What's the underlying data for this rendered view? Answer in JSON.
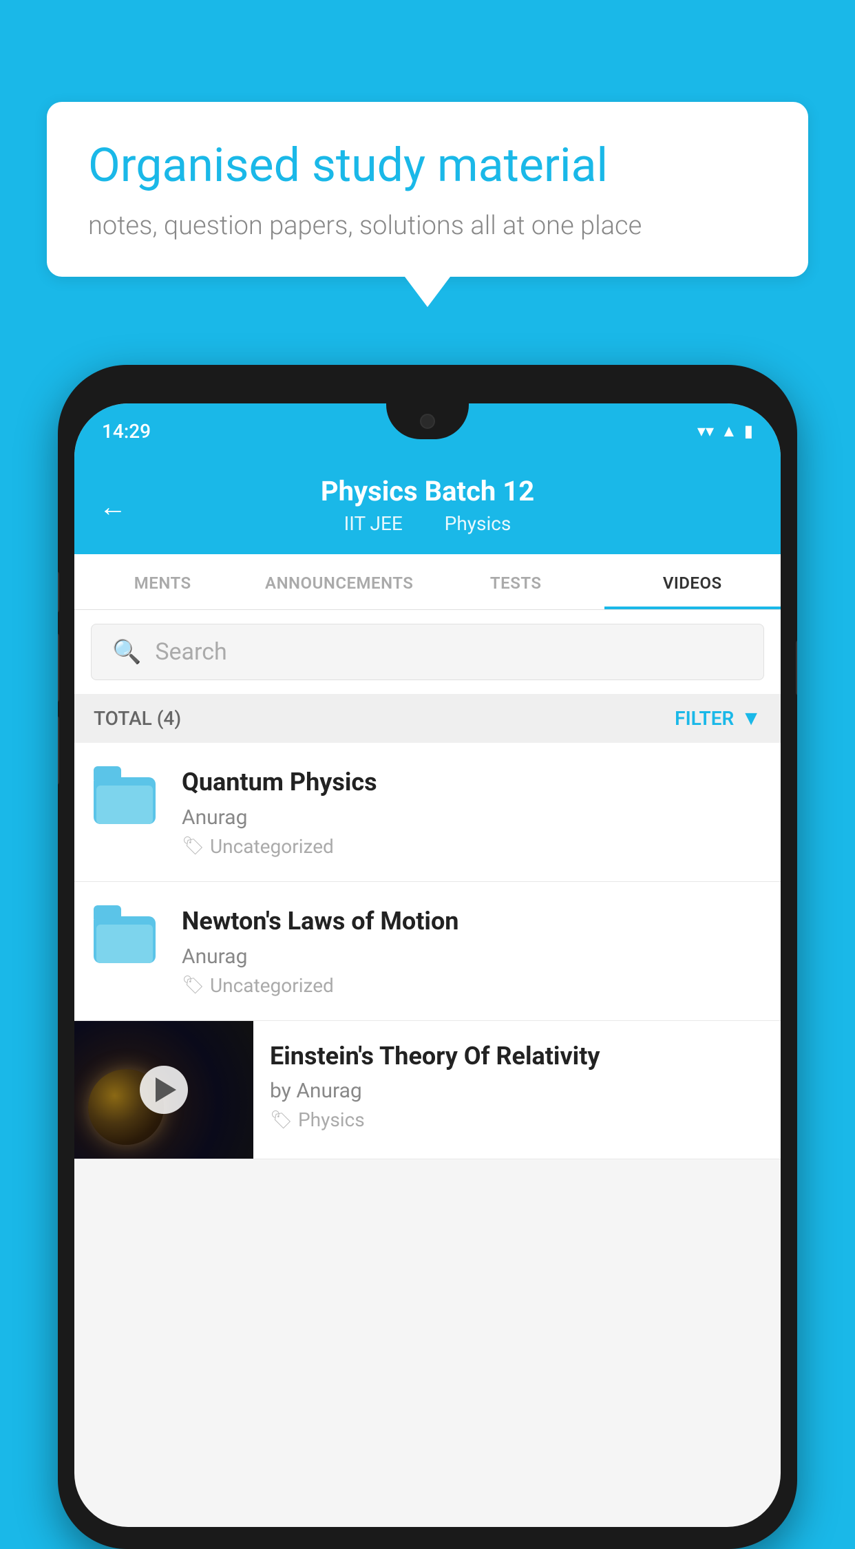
{
  "background_color": "#1ab8e8",
  "speech_bubble": {
    "title": "Organised study material",
    "subtitle": "notes, question papers, solutions all at one place"
  },
  "phone": {
    "status_bar": {
      "time": "14:29",
      "icons": [
        "wifi",
        "signal",
        "battery"
      ]
    },
    "app_header": {
      "title": "Physics Batch 12",
      "subtitle_part1": "IIT JEE",
      "subtitle_part2": "Physics",
      "back_label": "←"
    },
    "tabs": [
      {
        "label": "MENTS",
        "active": false
      },
      {
        "label": "ANNOUNCEMENTS",
        "active": false
      },
      {
        "label": "TESTS",
        "active": false
      },
      {
        "label": "VIDEOS",
        "active": true
      }
    ],
    "search": {
      "placeholder": "Search"
    },
    "filter_bar": {
      "total_label": "TOTAL (4)",
      "filter_label": "FILTER"
    },
    "video_items": [
      {
        "title": "Quantum Physics",
        "author": "Anurag",
        "tag": "Uncategorized",
        "type": "folder"
      },
      {
        "title": "Newton's Laws of Motion",
        "author": "Anurag",
        "tag": "Uncategorized",
        "type": "folder"
      },
      {
        "title": "Einstein's Theory Of Relativity",
        "author": "by Anurag",
        "tag": "Physics",
        "type": "video"
      }
    ]
  }
}
